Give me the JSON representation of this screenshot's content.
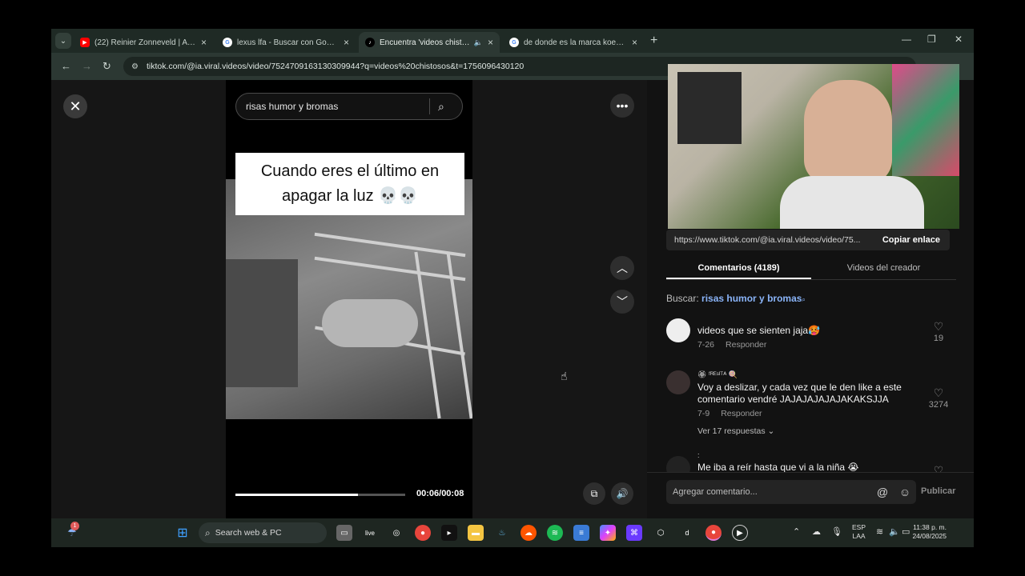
{
  "browser": {
    "tabs": [
      {
        "title": "(22) Reinier Zonneveld | Awaken",
        "favicon": "youtube-icon"
      },
      {
        "title": "lexus lfa - Buscar con Google",
        "favicon": "google-icon"
      },
      {
        "title": "Encuentra 'videos chistosos'",
        "favicon": "tiktok-icon"
      },
      {
        "title": "de donde es la marca koenigsegg",
        "favicon": "google-icon"
      }
    ],
    "url": "tiktok.com/@ia.viral.videos/video/7524709163130309944?q=videos%20chistosos&t=1756096430120"
  },
  "player": {
    "search_query": "risas humor y bromas",
    "caption_line1": "Cuando eres el último en",
    "caption_line2": "apagar la luz 💀💀",
    "progress": 0.72,
    "time": "00:06/00:08"
  },
  "side": {
    "share_link": "https://www.tiktok.com/@ia.viral.videos/video/75...",
    "copy_label": "Copiar enlace",
    "tabs": [
      "Comentarios (4189)",
      "Videos del creador"
    ],
    "search_label": "Buscar:",
    "search_term": "risas humor y bromas",
    "comments": [
      {
        "user": "",
        "text": "videos que se sienten jaja🥵",
        "date": "7-26",
        "reply": "Responder",
        "likes": "19",
        "more": ""
      },
      {
        "user": "🏵 ᶠᴿᴱˢᴵᵀᴬ 🍭",
        "text": "Voy a deslizar, y cada vez que le den like a este comentario vendré JAJAJAJAJAJAKAKSJJA",
        "date": "7-9",
        "reply": "Responder",
        "likes": "3274",
        "more": "Ver 17 respuestas ⌄"
      },
      {
        "user": ":",
        "text": "Me iba a reír hasta que vi a la niña 😭",
        "date": "",
        "reply": "",
        "likes": "",
        "more": ""
      }
    ],
    "compose_placeholder": "Agregar comentario...",
    "publish_label": "Publicar"
  },
  "taskbar": {
    "search_label": "Search web & PC",
    "lang_top": "ESP",
    "lang_bottom": "LAA",
    "time": "11:38 p. m.",
    "date": "24/08/2025",
    "badge": "1"
  }
}
